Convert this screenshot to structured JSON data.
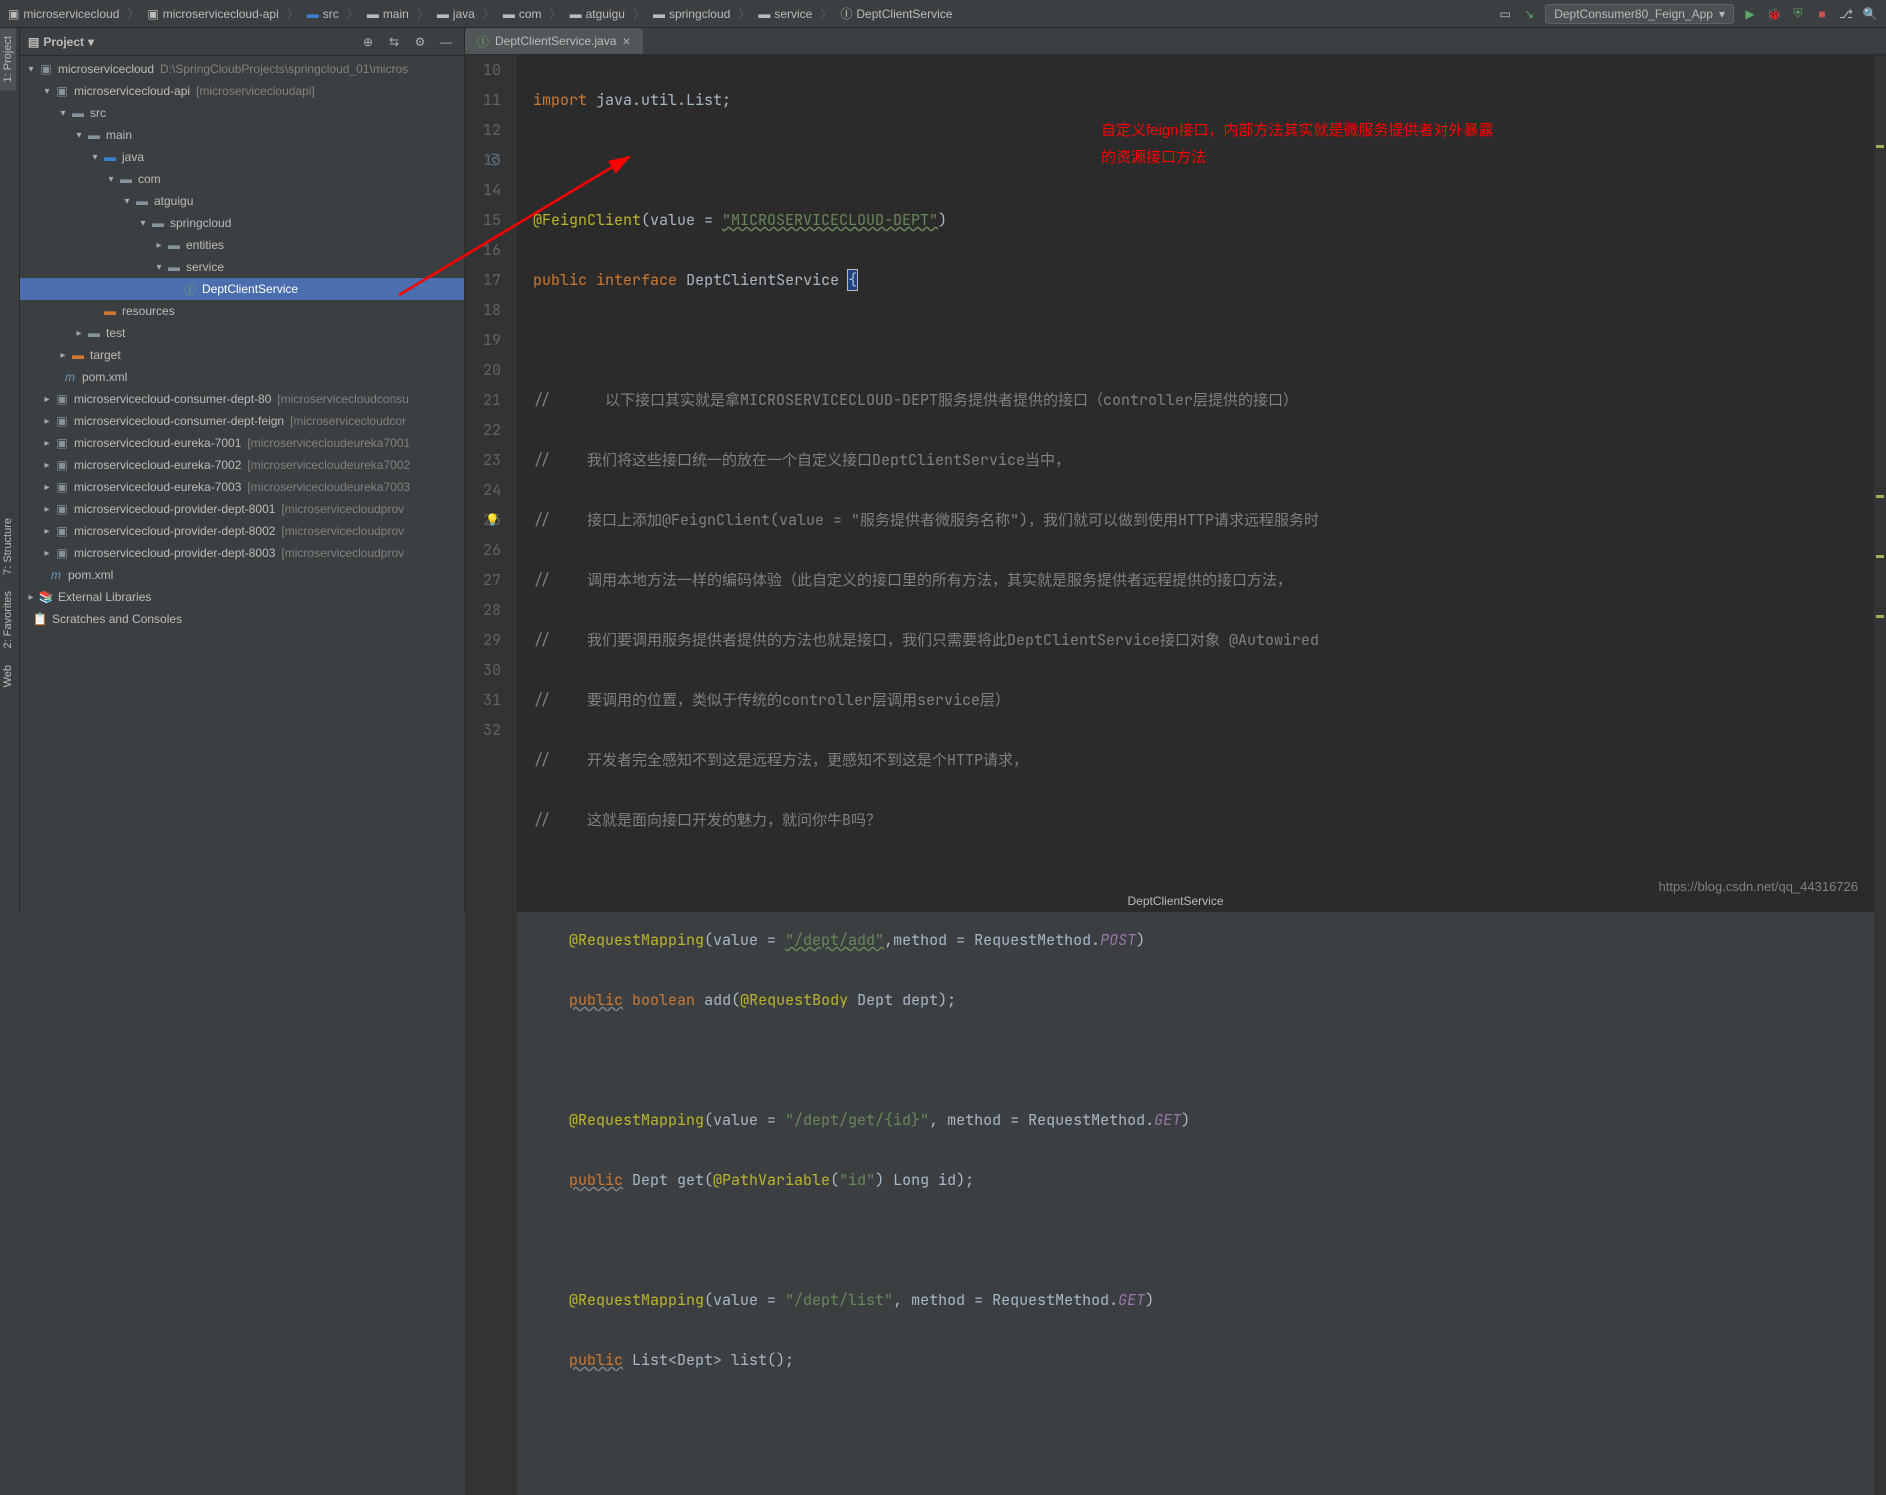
{
  "breadcrumb": [
    "microservicecloud",
    "microservicecloud-api",
    "src",
    "main",
    "java",
    "com",
    "atguigu",
    "springcloud",
    "service",
    "DeptClientService"
  ],
  "run_config": "DeptConsumer80_Feign_App",
  "left_tabs": {
    "project": "1: Project",
    "structure": "7: Structure",
    "favorites": "2: Favorites",
    "web": "Web"
  },
  "project_panel": {
    "title": "Project"
  },
  "tree_root": {
    "name": "microservicecloud",
    "path": "D:\\SpringCloubProjects\\springcloud_01\\micros"
  },
  "modules": {
    "api": {
      "name": "microservicecloud-api",
      "bracket": "[microservicecloudapi]"
    },
    "src": "src",
    "main": "main",
    "java": "java",
    "com": "com",
    "atguigu": "atguigu",
    "springcloud": "springcloud",
    "entities": "entities",
    "service": "service",
    "selected": "DeptClientService",
    "resources": "resources",
    "test": "test",
    "target": "target",
    "pom": "pom.xml",
    "consumer80": {
      "name": "microservicecloud-consumer-dept-80",
      "bracket": "[microservicecloudconsu"
    },
    "feign": {
      "name": "microservicecloud-consumer-dept-feign",
      "bracket": "[microservicecloudcor"
    },
    "e7001": {
      "name": "microservicecloud-eureka-7001",
      "bracket": "[microservicecloudeureka7001"
    },
    "e7002": {
      "name": "microservicecloud-eureka-7002",
      "bracket": "[microservicecloudeureka7002"
    },
    "e7003": {
      "name": "microservicecloud-eureka-7003",
      "bracket": "[microservicecloudeureka7003"
    },
    "p8001": {
      "name": "microservicecloud-provider-dept-8001",
      "bracket": "[microservicecloudprov"
    },
    "p8002": {
      "name": "microservicecloud-provider-dept-8002",
      "bracket": "[microservicecloudprov"
    },
    "p8003": {
      "name": "microservicecloud-provider-dept-8003",
      "bracket": "[microservicecloudprov"
    },
    "pom2": "pom.xml",
    "ext": "External Libraries",
    "scratch": "Scratches and Consoles"
  },
  "editor_tab": "DeptClientService.java",
  "line_start": 10,
  "line_end": 32,
  "code_lines": {
    "l10": {
      "pre": "import",
      "rest": " java.util.List;"
    },
    "l12_ann": "@FeignClient",
    "l12_val": "(value = ",
    "l12_str": "\"MICROSERVICECLOUD-DEPT\"",
    "l12_end": ")",
    "l13_pub": "public",
    "l13_int": "interface",
    "l13_name": "DeptClientService",
    "l13_brace": "{",
    "l15": "//      以下接口其实就是拿MICROSERVICECLOUD-DEPT服务提供者提供的接口（controller层提供的接口）",
    "l16": "//    我们将这些接口统一的放在一个自定义接口DeptClientService当中，",
    "l17": "//    接口上添加@FeignClient(value = \"服务提供者微服务名称\")，我们就可以做到使用HTTP请求远程服务时",
    "l18": "//    调用本地方法一样的编码体验（此自定义的接口里的所有方法，其实就是服务提供者远程提供的接口方法，",
    "l19": "//    我们要调用服务提供者提供的方法也就是接口，我们只需要将此DeptClientService接口对象 @Autowired",
    "l20": "//    要调用的位置，类似于传统的controller层调用service层）",
    "l21": "//    开发者完全感知不到这是远程方法，更感知不到这是个HTTP请求，",
    "l22": "//    这就是面向接口开发的魅力，就问你牛B吗？",
    "l24_ann": "@RequestMapping",
    "l24_args": "(value = ",
    "l24_str": "\"/dept/add\"",
    "l24_m": ",method = RequestMethod.",
    "l24_post": "POST",
    "l24_end": ")",
    "l25_pub": "public",
    "l25_bool": "boolean",
    "l25_add": " add(",
    "l25_rb": "@RequestBody",
    "l25_rest": " Dept dept);",
    "l27_ann": "@RequestMapping",
    "l27_args": "(value = ",
    "l27_str": "\"/dept/get/{id}\"",
    "l27_m": ", method = RequestMethod.",
    "l27_get": "GET",
    "l27_end": ")",
    "l28_pub": "public",
    "l28_rest": " Dept get(",
    "l28_pv": "@PathVariable",
    "l28_args": "(",
    "l28_str": "\"id\"",
    "l28_end": ") Long id);",
    "l30_ann": "@RequestMapping",
    "l30_args": "(value = ",
    "l30_str": "\"/dept/list\"",
    "l30_m": ", method = RequestMethod.",
    "l30_get": "GET",
    "l30_end": ")",
    "l31_pub": "public",
    "l31_rest": " List<Dept> list();"
  },
  "red_note_l1": "自定义feign接口，内部方法其实就是微服务提供者对外暴露",
  "red_note_l2": "的资源接口方法",
  "status": "DeptClientService",
  "watermark": "https://blog.csdn.net/qq_44316726"
}
